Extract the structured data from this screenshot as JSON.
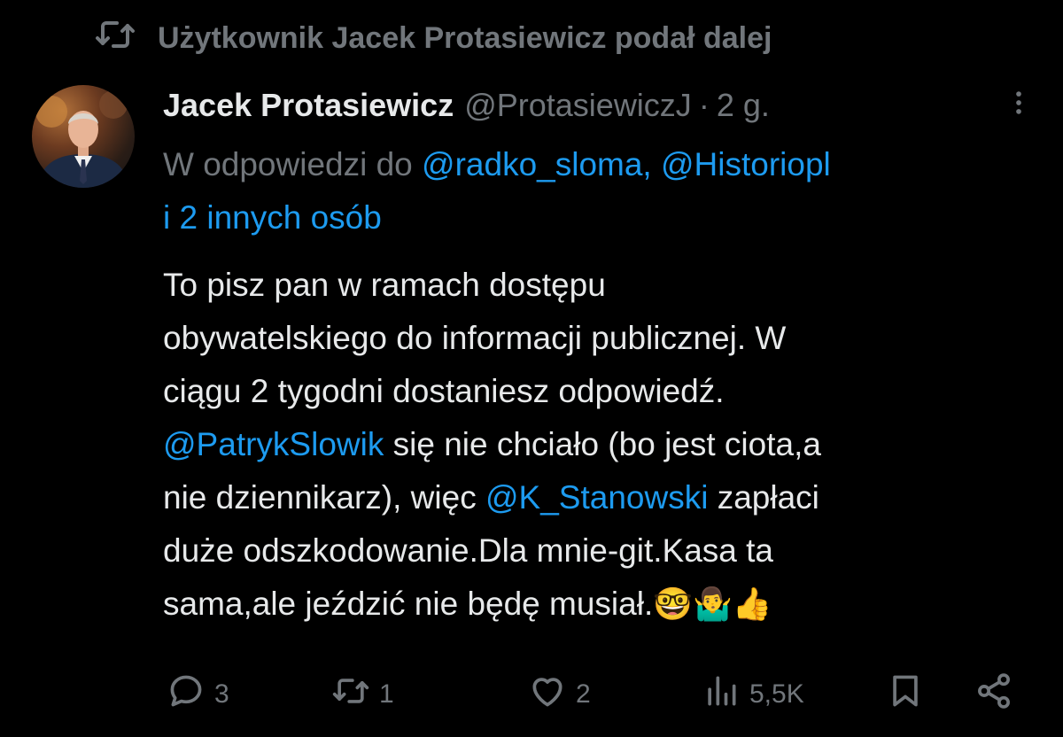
{
  "repost": {
    "label": "Użytkownik Jacek Protasiewicz podał dalej",
    "icon": "repost-icon"
  },
  "author": {
    "name": "Jacek Protasiewicz",
    "handle": "@ProtasiewiczJ",
    "separator": "·",
    "time": "2 g."
  },
  "reply": {
    "prefix": "W odpowiedzi do ",
    "mention1": "@radko_sloma,",
    "mention2": "@Historiopl",
    "others": "i 2 innych osób"
  },
  "tweet": {
    "line1": "To pisz pan w ramach dostępu",
    "line2": "obywatelskiego do informacji publicznej. W",
    "line3": "ciągu 2 tygodni dostaniesz odpowiedź.",
    "line4_mention": "@PatrykSlowik",
    "line4_text": " się nie chciało (bo jest ciota,a",
    "line5_pre": "nie dziennikarz), więc ",
    "line5_mention": "@K_Stanowski",
    "line5_post": " zapłaci",
    "line6": "duże odszkodowanie.Dla mnie-git.Kasa ta",
    "line7": "sama,ale jeździć nie będę musiał.",
    "emojis": "🤓🤷‍♂️👍"
  },
  "actions": {
    "replies": "3",
    "reposts": "1",
    "likes": "2",
    "views": "5,5K"
  },
  "colors": {
    "background": "#000000",
    "text": "#e7e9ea",
    "muted": "#71767b",
    "link": "#1d9bf0"
  }
}
